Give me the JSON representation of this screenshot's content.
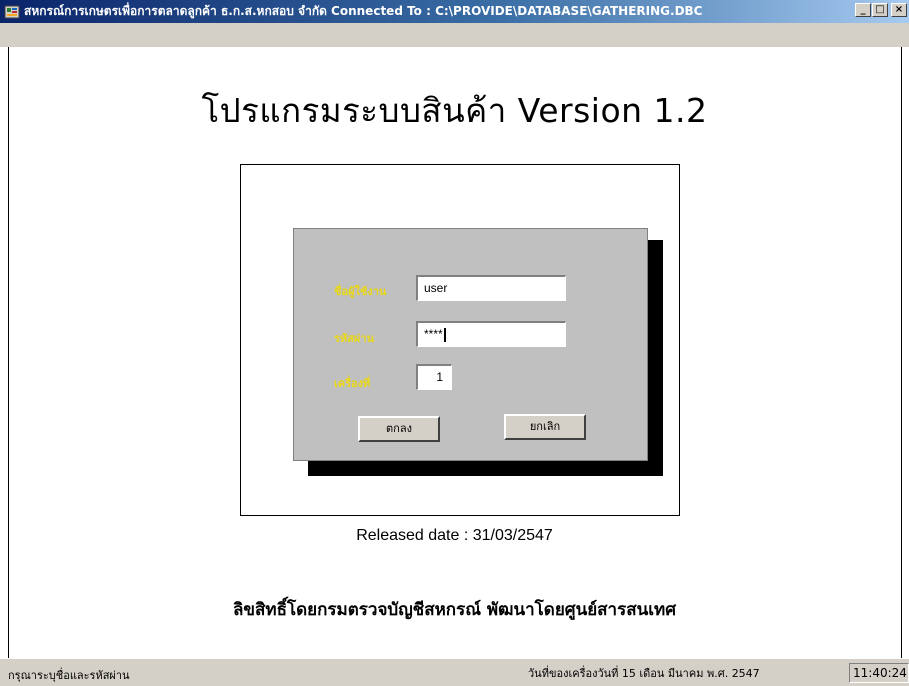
{
  "window": {
    "title": "สหกรณ์การเกษตรเพื่อการตลาดลูกค้า ธ.ก.ส.หกสอบ จำกัด   Connected To : C:\\PROVIDE\\DATABASE\\GATHERING.DBC",
    "app_icon": "app-icon",
    "buttons": {
      "minimize": "_",
      "maximize": "□",
      "close": "×"
    }
  },
  "main": {
    "title": "โปรแกรมระบบสินค้า Version 1.2",
    "released": "Released  date : 31/03/2547",
    "copyright": "ลิขสิทธิ์โดยกรมตรวจบัญชีสหกรณ์ พัฒนาโดยศูนย์สารสนเทศ"
  },
  "login": {
    "username_label": "ชื่อผู้ใช้งาน",
    "username_value": "user",
    "password_label": "รหัสผ่าน",
    "password_value": "****",
    "machine_label": "เครื่องที่",
    "machine_value": "1",
    "ok_label": "ตกลง",
    "cancel_label": "ยกเลิก"
  },
  "status": {
    "left": "กรุณาระบุชื่อและรหัสผ่าน",
    "date": "วันที่ของเครื่องวันที่ 15 เดือน มีนาคม  พ.ศ. 2547",
    "time": "11:40:24"
  },
  "colors": {
    "titlebar_start": "#0a246a",
    "titlebar_end": "#a6caf0",
    "panel": "#c0c0c0",
    "label_yellow": "#f5e60a"
  }
}
